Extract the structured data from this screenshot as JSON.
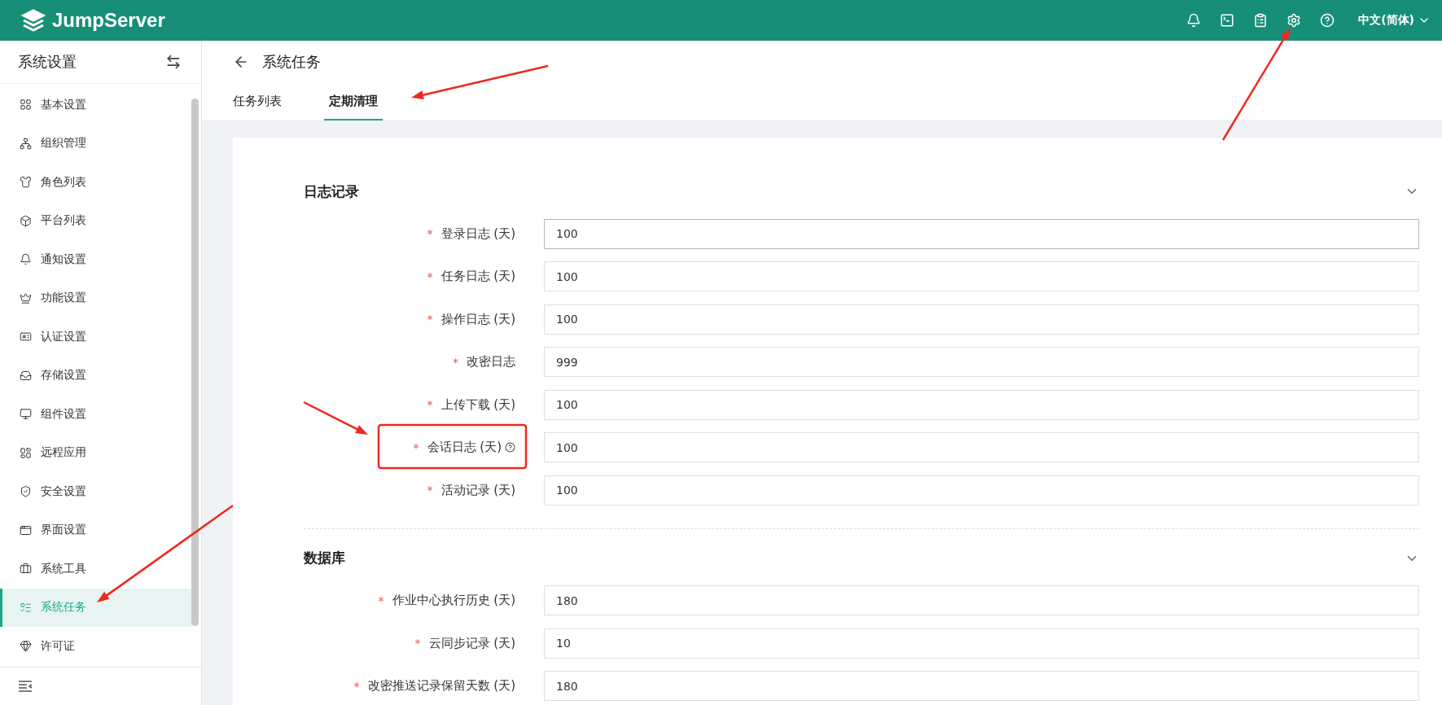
{
  "header": {
    "logo": "JumpServer",
    "language": "中文(简体)"
  },
  "sidebar": {
    "title": "系统设置",
    "items": [
      {
        "label": "基本设置",
        "selected": false
      },
      {
        "label": "组织管理",
        "selected": false
      },
      {
        "label": "角色列表",
        "selected": false
      },
      {
        "label": "平台列表",
        "selected": false
      },
      {
        "label": "通知设置",
        "selected": false
      },
      {
        "label": "功能设置",
        "selected": false
      },
      {
        "label": "认证设置",
        "selected": false
      },
      {
        "label": "存储设置",
        "selected": false
      },
      {
        "label": "组件设置",
        "selected": false
      },
      {
        "label": "远程应用",
        "selected": false
      },
      {
        "label": "安全设置",
        "selected": false
      },
      {
        "label": "界面设置",
        "selected": false
      },
      {
        "label": "系统工具",
        "selected": false
      },
      {
        "label": "系统任务",
        "selected": true
      },
      {
        "label": "许可证",
        "selected": false
      }
    ]
  },
  "page": {
    "title": "系统任务",
    "tabs": [
      {
        "label": "任务列表",
        "selected": false
      },
      {
        "label": "定期清理",
        "selected": true
      }
    ]
  },
  "sections": [
    {
      "title": "日志记录",
      "expanded": true,
      "fields": [
        {
          "required_mark": "*",
          "label": "登录日志 (天)",
          "help": false,
          "focused": true,
          "value": "100"
        },
        {
          "required_mark": "*",
          "label": "任务日志 (天)",
          "help": false,
          "focused": false,
          "value": "100"
        },
        {
          "required_mark": "*",
          "label": "操作日志 (天)",
          "help": false,
          "focused": false,
          "value": "100"
        },
        {
          "required_mark": "*",
          "label": "改密日志",
          "help": false,
          "focused": false,
          "value": "999"
        },
        {
          "required_mark": "*",
          "label": "上传下载 (天)",
          "help": false,
          "focused": false,
          "value": "100"
        },
        {
          "required_mark": "*",
          "label": "会话日志 (天)",
          "help": true,
          "focused": false,
          "value": "100"
        },
        {
          "required_mark": "*",
          "label": "活动记录 (天)",
          "help": false,
          "focused": false,
          "value": "100"
        }
      ]
    },
    {
      "title": "数据库",
      "expanded": true,
      "fields": [
        {
          "required_mark": "*",
          "label": "作业中心执行历史 (天)",
          "help": false,
          "focused": false,
          "value": "180"
        },
        {
          "required_mark": "*",
          "label": "云同步记录 (天)",
          "help": false,
          "focused": false,
          "value": "10"
        },
        {
          "required_mark": "*",
          "label": "改密推送记录保留天数 (天)",
          "help": false,
          "focused": false,
          "value": "180"
        }
      ]
    }
  ]
}
